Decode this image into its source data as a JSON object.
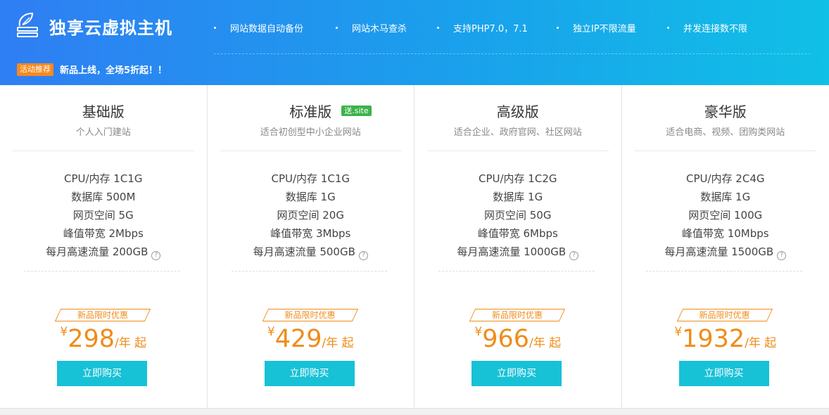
{
  "header": {
    "title": "独享云虚拟主机",
    "features": [
      "网站数据自动备份",
      "网站木马查杀",
      "支持PHP7.0，7.1",
      "独立IP不限流量",
      "并发连接数不限"
    ],
    "promo_tag": "活动推荐",
    "promo_text": "新品上线，全场5折起！！"
  },
  "plans": [
    {
      "name": "基础版",
      "badge": "",
      "desc": "个人入门建站",
      "specs": [
        "CPU/内存 1C1G",
        "数据库 500M",
        "网页空间 5G",
        "峰值带宽 2Mbps",
        "每月高速流量 200GB"
      ],
      "promo": "新品限时优惠",
      "currency": "¥",
      "price": "298",
      "unit": "/年 起",
      "button": "立即购买"
    },
    {
      "name": "标准版",
      "badge": "送.site",
      "desc": "适合初创型中小企业网站",
      "specs": [
        "CPU/内存 1C1G",
        "数据库 1G",
        "网页空间 20G",
        "峰值带宽 3Mbps",
        "每月高速流量 500GB"
      ],
      "promo": "新品限时优惠",
      "currency": "¥",
      "price": "429",
      "unit": "/年 起",
      "button": "立即购买"
    },
    {
      "name": "高级版",
      "badge": "",
      "desc": "适合企业、政府官网、社区网站",
      "specs": [
        "CPU/内存 1C2G",
        "数据库 1G",
        "网页空间 50G",
        "峰值带宽 6Mbps",
        "每月高速流量 1000GB"
      ],
      "promo": "新品限时优惠",
      "currency": "¥",
      "price": "966",
      "unit": "/年 起",
      "button": "立即购买"
    },
    {
      "name": "豪华版",
      "badge": "",
      "desc": "适合电商、视频、团购类网站",
      "specs": [
        "CPU/内存 2C4G",
        "数据库 1G",
        "网页空间 100G",
        "峰值带宽 10Mbps",
        "每月高速流量 1500GB"
      ],
      "promo": "新品限时优惠",
      "currency": "¥",
      "price": "1932",
      "unit": "/年 起",
      "button": "立即购买"
    }
  ],
  "help_icon_glyph": "?",
  "colors": {
    "header_start": "#2f7ef3",
    "header_end": "#10c0e6",
    "promo_tag": "#f7891e",
    "price": "#f08c1a",
    "button": "#17c1d6",
    "badge": "#3bb34a"
  },
  "icons": {
    "brand": "leaf-server-icon",
    "help": "question-circle-icon"
  }
}
